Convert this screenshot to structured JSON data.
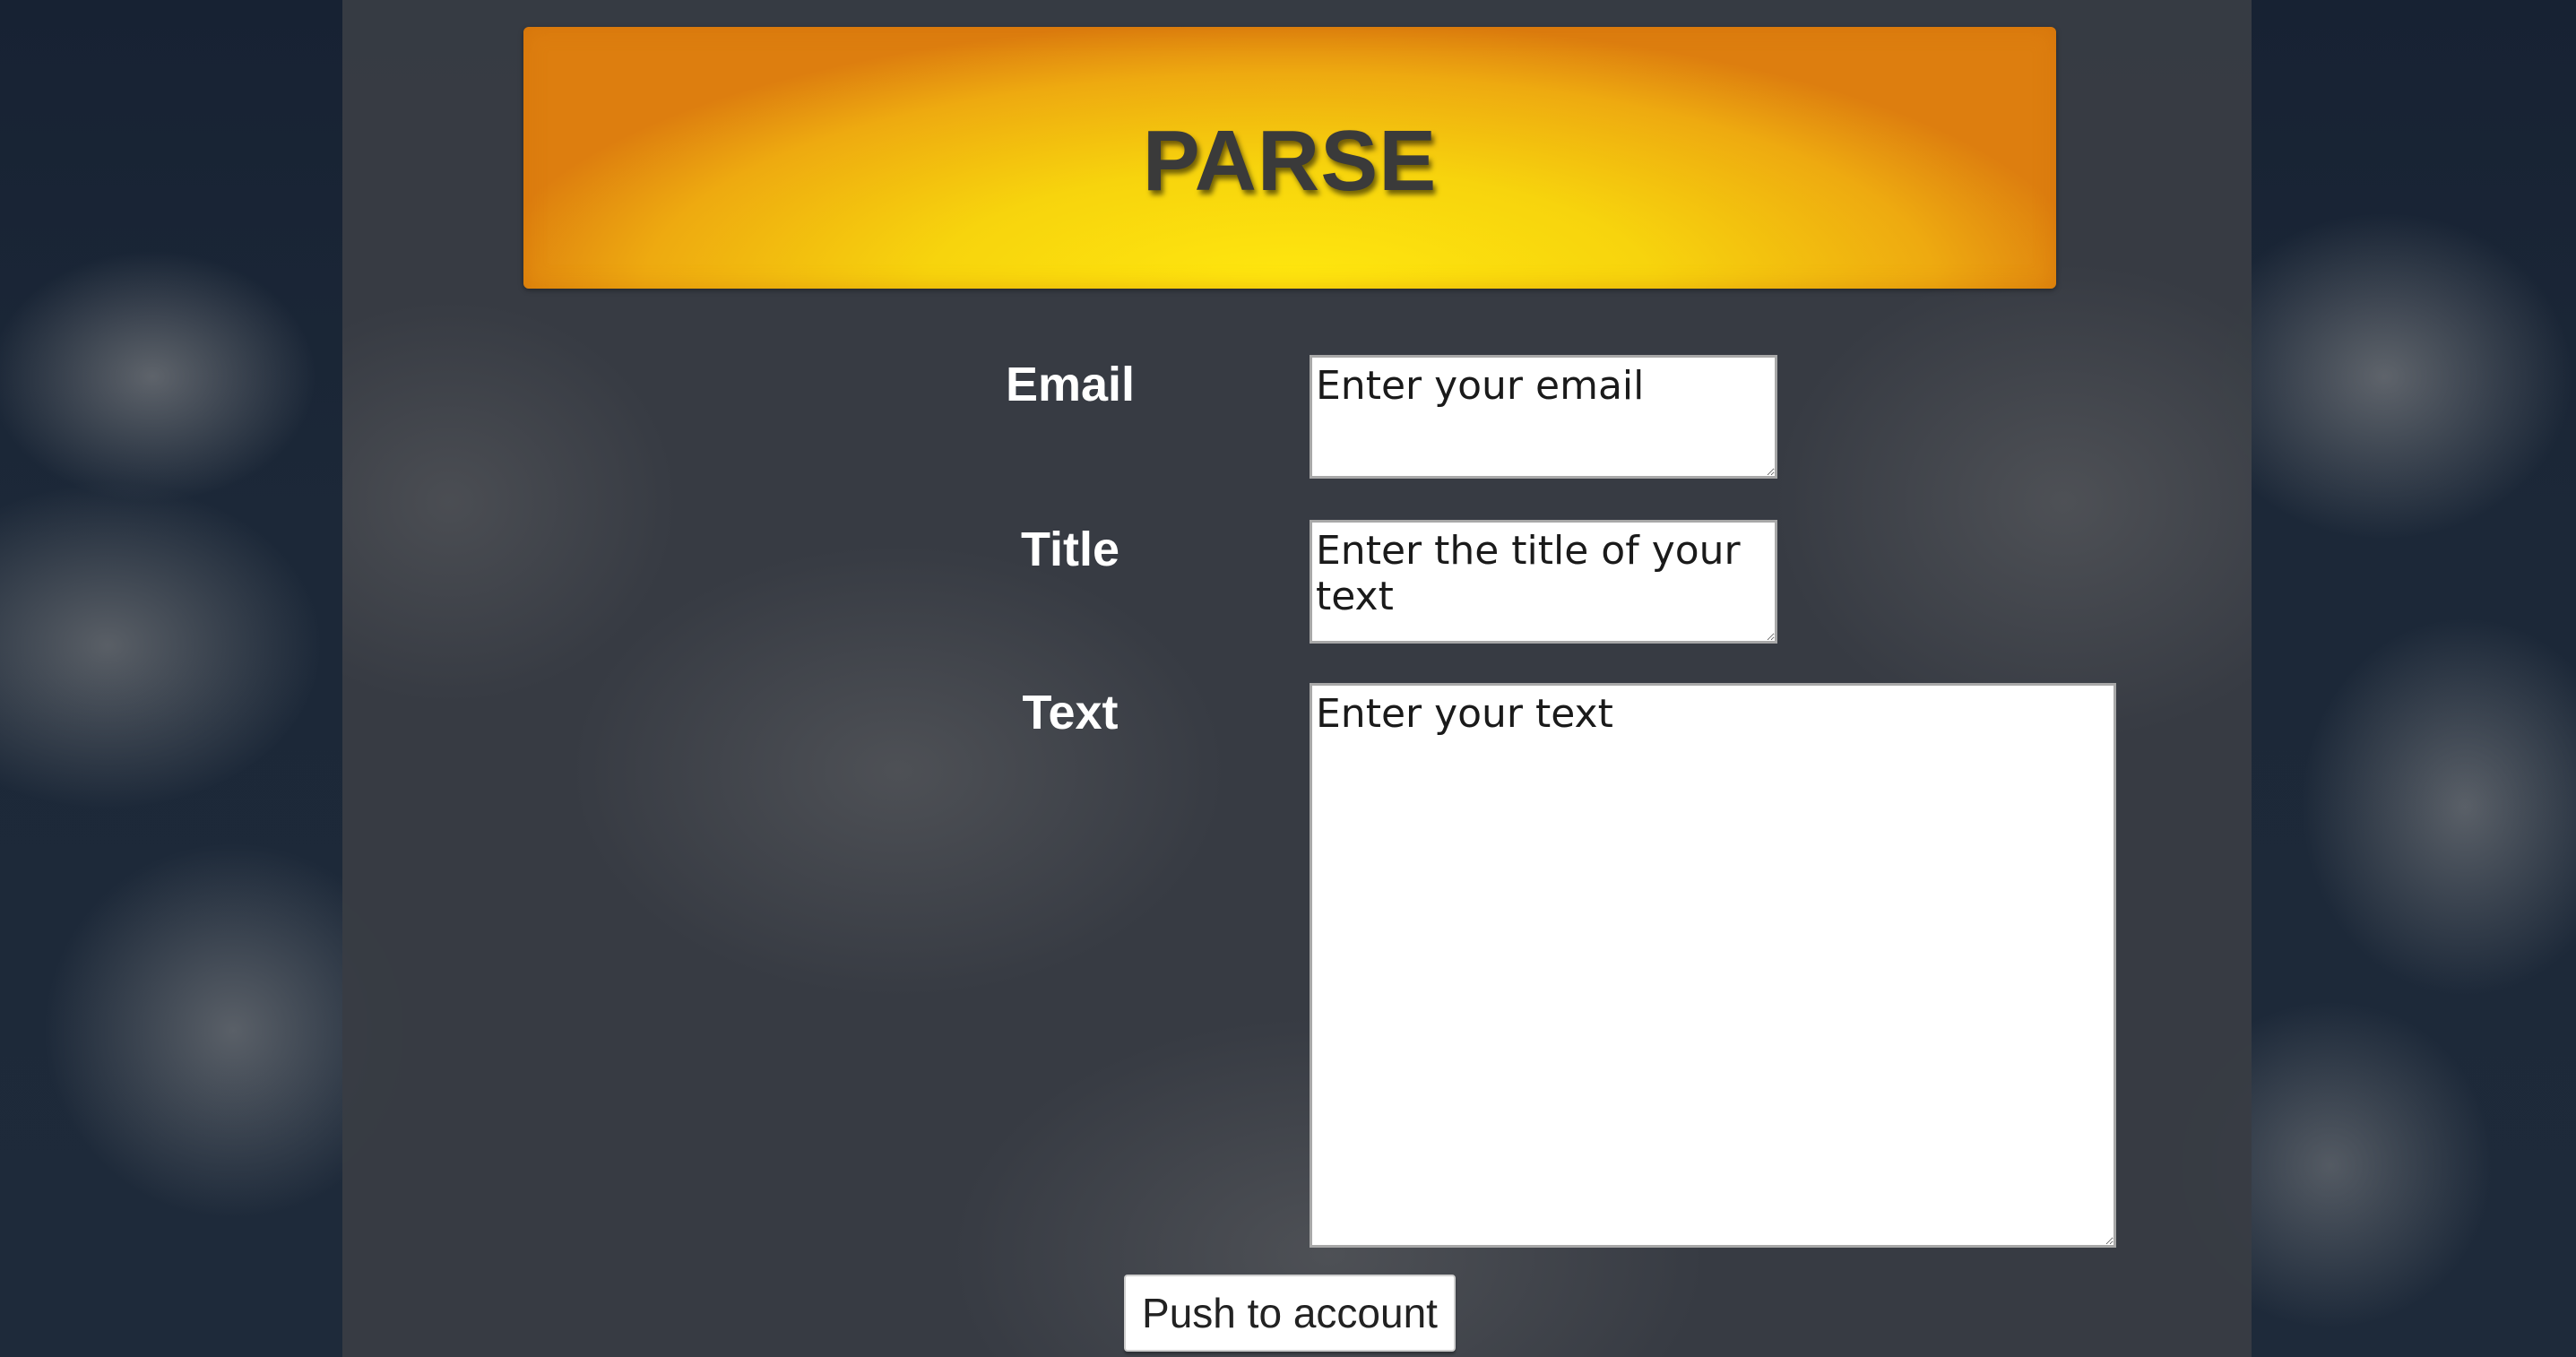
{
  "header": {
    "title": "PARSE"
  },
  "form": {
    "email": {
      "label": "Email",
      "placeholder": "Enter your email"
    },
    "title": {
      "label": "Title",
      "placeholder": "Enter the title of your text"
    },
    "text": {
      "label": "Text",
      "placeholder": "Enter your text"
    },
    "submit_label": "Push to account"
  },
  "colors": {
    "banner_center": "#ffe80e",
    "banner_edge": "#dd7e0f",
    "panel": "#383c44",
    "background": "#172233"
  }
}
